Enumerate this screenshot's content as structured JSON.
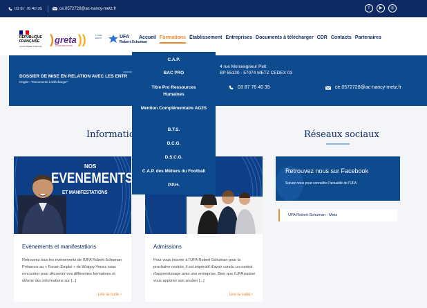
{
  "topbar": {
    "phone": "03 87 76 40 35",
    "email": "ce.0572728@ac-nancy-metz.fr",
    "social_icons": [
      "facebook-icon",
      "youtube-icon",
      "instagram-icon"
    ]
  },
  "logos": {
    "republique": {
      "line1": "RÉPUBLIQUE",
      "line2": "FRANÇAISE",
      "motto": "Liberté Égalité Fraternité"
    },
    "greta": {
      "name": "greta",
      "sub": "LORRAINE NORD"
    },
    "ufa": {
      "lycee": "LYCÉE ÉDITS",
      "name": "UFA",
      "name2": "Robert Schuman"
    }
  },
  "nav": {
    "items": [
      "Accueil",
      "Formations",
      "Établissement",
      "Entreprises",
      "Documents à télécharger",
      "CDR",
      "Contacts",
      "Partenaires"
    ],
    "active_index": 1
  },
  "hero": {
    "title": "DOSSIER DE MISE EN RELATION AVEC LES ENTR",
    "subtitle": "Onglet : \"Documents à télécharger\"",
    "address_line1": "4 rue Monseigneur Pelt",
    "address_line2": "BP 55130 - 57074 METZ CEDEX 03",
    "phone": "03 87 76 40 35",
    "email": "ce.0572728@ac-nancy-metz.fr"
  },
  "dropdown": {
    "items": [
      "C.A.P.",
      "BAC PRO",
      "Titre Pro Ressources Humaines",
      "Mention Complémentaire AG2S",
      "B.T.S.",
      "D.C.G.",
      "D.S.C.G.",
      "C.A.P. des Métiers du Football",
      "P.P.H."
    ]
  },
  "sections": {
    "information_title": "Informatio",
    "social_title": "Réseaux sociaux"
  },
  "cards": [
    {
      "banner_small": "NOS",
      "banner_big": "EVENEMENTS",
      "banner_sub": "ET MANIFESTATIONS",
      "title": "Evènements et manifestations",
      "text": "Retrouvez tous les évènements de l'UFA Robert Schuman Présence au « Forum Emploi » de Woippy Venez nous rencontrer pour découvrir nos différentes formations et obtenir des informations sur [...]",
      "more": "Lire la suite"
    },
    {
      "banner_big": "S",
      "title": "Admissions",
      "text": "Pour vous inscrire à l'UFA Robert Schuman pour la prochaine rentrée, il est impératif d'avoir conclu un contrat d'apprentissage avec une entreprise. Bien que l'UFA puisse vous apporter son soutien [...]",
      "more": "Lire la suite"
    }
  ],
  "facebook": {
    "title": "Retrouvez nous sur Facebook",
    "subtitle": "Suivez nous pour connaître l'actualité de l'UFA"
  },
  "ufa_link": "UFA Robert Schuman - Metz",
  "colors": {
    "navy": "#0e2a63",
    "blue": "#0e4a8e",
    "orange": "#f08a2a"
  }
}
